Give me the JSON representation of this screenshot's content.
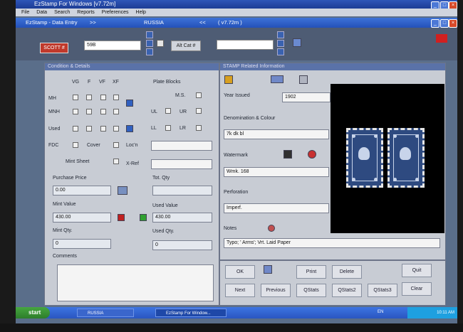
{
  "window": {
    "title": "EzStamp For Windows [v7.72m]",
    "menu": [
      "File",
      "Data",
      "Search",
      "Reports",
      "Preferences",
      "Help"
    ]
  },
  "data_entry": {
    "title": "EzStamp - Data Entry",
    "nav_left": ">>",
    "country": "RUSSIA",
    "nav_right": "<<",
    "version": "( v7.72m )"
  },
  "top": {
    "scott_label": "SCOTT #",
    "scott_value": "59B",
    "alt_cat_label": "Alt Cat #",
    "alt_cat_value": ""
  },
  "condition": {
    "title": "Condition & Details",
    "grades": [
      "VG",
      "F",
      "VF",
      "XF"
    ],
    "rows": [
      "MH",
      "MNH",
      "Used"
    ],
    "plate_blocks": "Plate Blocks",
    "ms": "M.S.",
    "ul": "UL",
    "ur": "UR",
    "ll": "LL",
    "lr": "LR",
    "fdc": "FDC",
    "cover": "Cover",
    "locn": "Loc'n",
    "mint_sheet": "Mint Sheet",
    "xref": "X-Ref",
    "purchase_price_label": "Purchase Price",
    "purchase_price": "0.00",
    "tot_qty_label": "Tot. Qty",
    "tot_qty": "",
    "mint_value_label": "Mint Value",
    "mint_value": "430.00",
    "used_value_label": "Used Value",
    "used_value": "430.00",
    "mint_qty_label": "Mint Qty.",
    "mint_qty": "0",
    "used_qty_label": "Used Qty.",
    "used_qty": "0",
    "comments_label": "Comments",
    "comments": ""
  },
  "stamp_info": {
    "title": "STAMP Related Information",
    "year_label": "Year Issued",
    "year": "1902",
    "denom_label": "Denomination & Colour",
    "denom": "7k dk bl",
    "watermark_label": "Watermark",
    "watermark": "Wmk. 168",
    "perforation_label": "Perforation",
    "perforation": "Imperf.",
    "notes_label": "Notes",
    "notes": "Typo; ' Arms'; Vrt. Laid Paper"
  },
  "buttons": {
    "ok": "OK",
    "print": "Print",
    "delete": "Delete",
    "quit": "Quit",
    "next": "Next",
    "previous": "Previous",
    "qstats": "QStats",
    "qstats2": "QStats2",
    "qstats3": "QStats3",
    "clear": "Clear"
  },
  "taskbar": {
    "start": "start",
    "task1": "RUSSIA",
    "task2": "EzStamp For Window...",
    "lang": "EN",
    "clock": "10:11 AM"
  },
  "colors": {
    "scott_red": "#c0392b",
    "panel_gray": "#c8ccd4",
    "title_blue": "#2451b9"
  }
}
